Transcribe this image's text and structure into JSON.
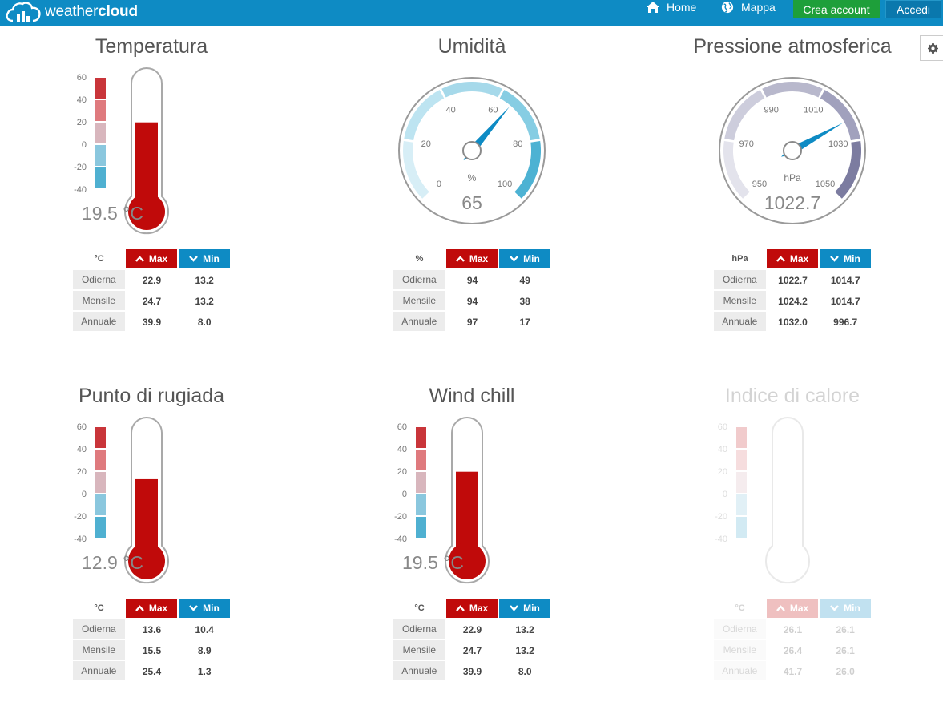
{
  "header": {
    "logo_light": "weather",
    "logo_bold": "cloud",
    "home_label": "Home",
    "map_label": "Mappa",
    "create_account_label": "Crea account",
    "login_label": "Accedi"
  },
  "colors": {
    "header": "#0e8bc4",
    "create": "#1e9f3a",
    "max": "#c00a0a",
    "min": "#0e8bc4",
    "mercury": "#c00a0a"
  },
  "row_labels": [
    "Odierna",
    "Mensile",
    "Annuale"
  ],
  "max_label": "Max",
  "min_label": "Min",
  "thermo_ticks": [
    "60",
    "40",
    "20",
    "0",
    "-20",
    "-40"
  ],
  "temperature": {
    "title": "Temperatura",
    "value": 19.5,
    "display": "19.5 °C",
    "unit": "°C",
    "stats": [
      [
        "22.9",
        "13.2"
      ],
      [
        "24.7",
        "13.2"
      ],
      [
        "39.9",
        "8.0"
      ]
    ]
  },
  "humidity": {
    "title": "Umidità",
    "value": 65,
    "display": "65",
    "unit": "%",
    "ticks": [
      "0",
      "20",
      "40",
      "60",
      "80",
      "100"
    ],
    "stats": [
      [
        "94",
        "49"
      ],
      [
        "94",
        "38"
      ],
      [
        "97",
        "17"
      ]
    ]
  },
  "pressure": {
    "title": "Pressione atmosferica",
    "value": 1022.7,
    "display": "1022.7",
    "unit": "hPa",
    "ticks": [
      "950",
      "970",
      "990",
      "1010",
      "1030",
      "1050"
    ],
    "stats": [
      [
        "1022.7",
        "1014.7"
      ],
      [
        "1024.2",
        "1014.7"
      ],
      [
        "1032.0",
        "996.7"
      ]
    ]
  },
  "dew_point": {
    "title": "Punto di rugiada",
    "value": 12.9,
    "display": "12.9 °C",
    "unit": "°C",
    "stats": [
      [
        "13.6",
        "10.4"
      ],
      [
        "15.5",
        "8.9"
      ],
      [
        "25.4",
        "1.3"
      ]
    ]
  },
  "wind_chill": {
    "title": "Wind chill",
    "value": 19.5,
    "display": "19.5 °C",
    "unit": "°C",
    "stats": [
      [
        "22.9",
        "13.2"
      ],
      [
        "24.7",
        "13.2"
      ],
      [
        "39.9",
        "8.0"
      ]
    ]
  },
  "heat_index": {
    "title": "Indice di calore",
    "unit": "°C",
    "stats": [
      [
        "26.1",
        "26.1"
      ],
      [
        "26.4",
        "26.1"
      ],
      [
        "41.7",
        "26.0"
      ]
    ]
  }
}
